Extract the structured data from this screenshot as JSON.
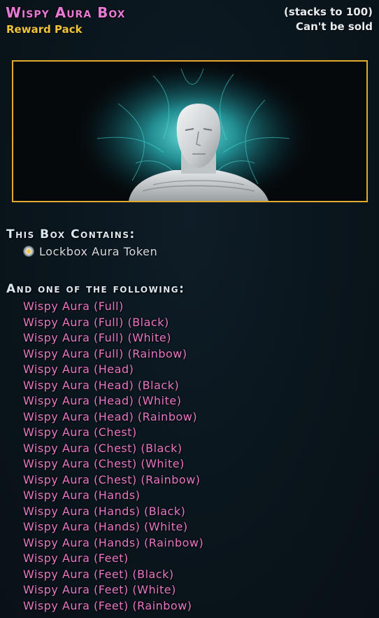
{
  "header": {
    "title": "Wispy Aura Box",
    "subtitle": "Reward Pack",
    "stack_info": "(stacks to 100)",
    "sell_info": "Can't be sold"
  },
  "preview": {
    "icon": "avatar-with-cyan-aura-image"
  },
  "contents": {
    "heading": "This Box Contains:",
    "items": [
      {
        "icon": "aura-token-icon",
        "label": "Lockbox Aura Token"
      }
    ]
  },
  "choices": {
    "heading": "And one of the following:",
    "items": [
      "Wispy Aura (Full)",
      "Wispy Aura (Full) (Black)",
      "Wispy Aura (Full) (White)",
      "Wispy Aura (Full) (Rainbow)",
      "Wispy Aura (Head)",
      "Wispy Aura (Head) (Black)",
      "Wispy Aura (Head) (White)",
      "Wispy Aura (Head) (Rainbow)",
      "Wispy Aura (Chest)",
      "Wispy Aura (Chest) (Black)",
      "Wispy Aura (Chest) (White)",
      "Wispy Aura (Chest) (Rainbow)",
      "Wispy Aura (Hands)",
      "Wispy Aura (Hands) (Black)",
      "Wispy Aura (Hands) (White)",
      "Wispy Aura (Hands) (Rainbow)",
      "Wispy Aura (Feet)",
      "Wispy Aura (Feet) (Black)",
      "Wispy Aura (Feet) (White)",
      "Wispy Aura (Feet) (Rainbow)"
    ]
  },
  "colors": {
    "title": "#e77ad6",
    "subtitle": "#f0c43a",
    "frame_border": "#e0aa2c",
    "reward_text": "#e879c8",
    "aura": "#3fd8dc"
  }
}
